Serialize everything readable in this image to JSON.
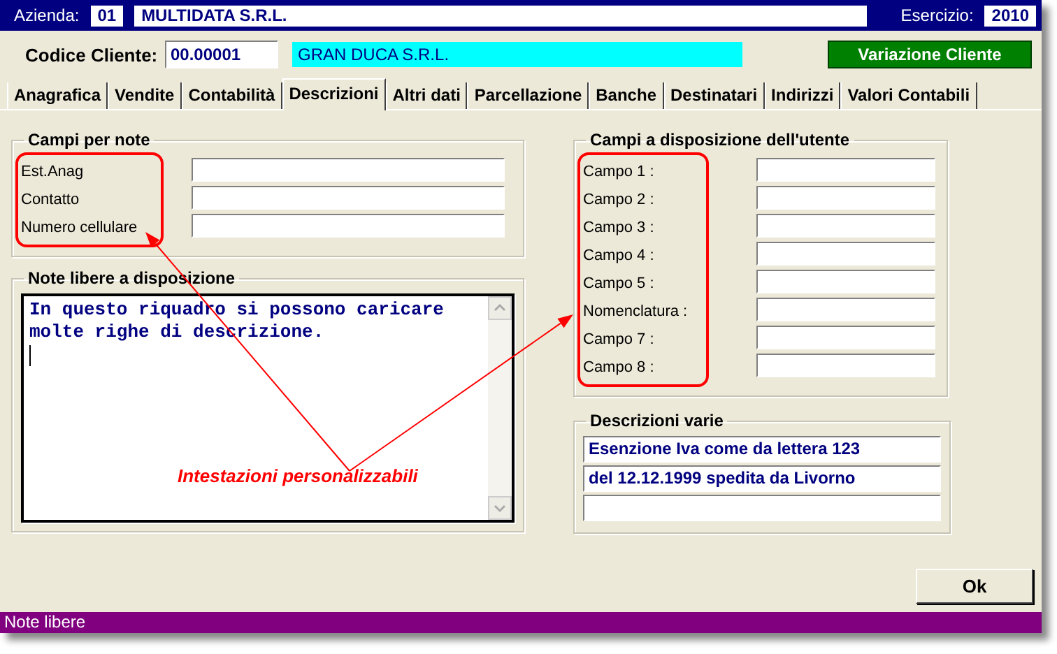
{
  "header": {
    "company_label": "Azienda:",
    "company_code": "01",
    "company_name": "MULTIDATA S.R.L.",
    "year_label": "Esercizio:",
    "year": "2010"
  },
  "customer": {
    "label": "Codice Cliente:",
    "code": "00.00001",
    "name": "GRAN DUCA S.R.L.",
    "action": "Variazione Cliente"
  },
  "tabs": [
    {
      "label": "Anagrafica",
      "selected": false
    },
    {
      "label": "Vendite",
      "selected": false
    },
    {
      "label": "Contabilità",
      "selected": false
    },
    {
      "label": "Descrizioni",
      "selected": true
    },
    {
      "label": "Altri dati",
      "selected": false
    },
    {
      "label": "Parcellazione",
      "selected": false
    },
    {
      "label": "Banche",
      "selected": false
    },
    {
      "label": "Destinatari",
      "selected": false
    },
    {
      "label": "Indirizzi",
      "selected": false
    },
    {
      "label": "Valori Contabili",
      "selected": false
    }
  ],
  "note_fields": {
    "title": "Campi per note",
    "fields": [
      {
        "label": "Est.Anag"
      },
      {
        "label": "Contatto"
      },
      {
        "label": "Numero cellulare"
      }
    ]
  },
  "free_notes": {
    "title": "Note libere a disposizione",
    "value": "In questo riquadro si possono caricare molte righe di descrizione."
  },
  "user_fields": {
    "title": "Campi a disposizione dell'utente",
    "fields": [
      {
        "label": "Campo 1 :"
      },
      {
        "label": "Campo 2 :"
      },
      {
        "label": "Campo 3 :"
      },
      {
        "label": "Campo 4 :"
      },
      {
        "label": "Campo 5 :"
      },
      {
        "label": "Nomenclatura :"
      },
      {
        "label": "Campo 7 :"
      },
      {
        "label": "Campo 8 :"
      }
    ]
  },
  "descriptions": {
    "title": "Descrizioni varie",
    "lines": [
      {
        "value": "Esenzione Iva come da lettera 123"
      },
      {
        "value": "del 12.12.1999 spedita da Livorno"
      }
    ]
  },
  "ok_button": "Ok",
  "annotation": "Intestazioni personalizzabili",
  "status_bar": "Note libere"
}
